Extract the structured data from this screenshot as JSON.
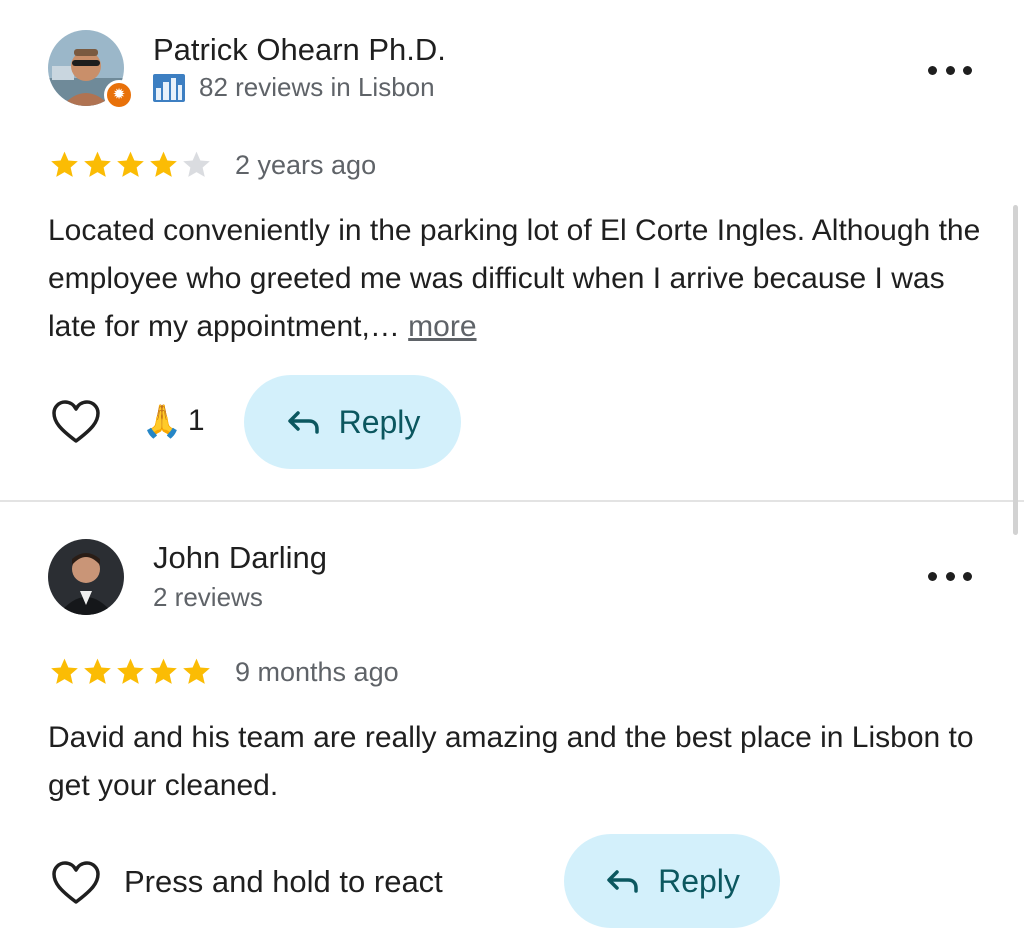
{
  "reviews": [
    {
      "author": "Patrick Ohearn Ph.D.",
      "meta": "82 reviews in Lisbon",
      "rating": 4,
      "time": "2 years ago",
      "text": "Located conveniently in the parking lot of El Corte Ingles. Although the employee who greeted me was difficult when I arrive because I was late for my appointment,…",
      "more_label": "more",
      "reaction_emoji": "🙏",
      "reaction_count": "1",
      "reply_label": "Reply"
    },
    {
      "author": "John Darling",
      "meta": "2 reviews",
      "rating": 5,
      "time": "9 months ago",
      "text": "David and his team are really amazing and the best place in Lisbon to get your cleaned.",
      "react_hint": "Press and hold to react",
      "reply_label": "Reply"
    }
  ],
  "colors": {
    "star_filled": "#fbbc04",
    "star_empty": "#dadce0",
    "reply_bg": "#d3f0fb",
    "reply_text": "#0b575f",
    "local_guide_badge": "#e8710a"
  },
  "icons": [
    "local-guide-badge-icon",
    "city-icon",
    "more-options-icon",
    "star-icon",
    "heart-icon",
    "reply-arrow-icon"
  ]
}
